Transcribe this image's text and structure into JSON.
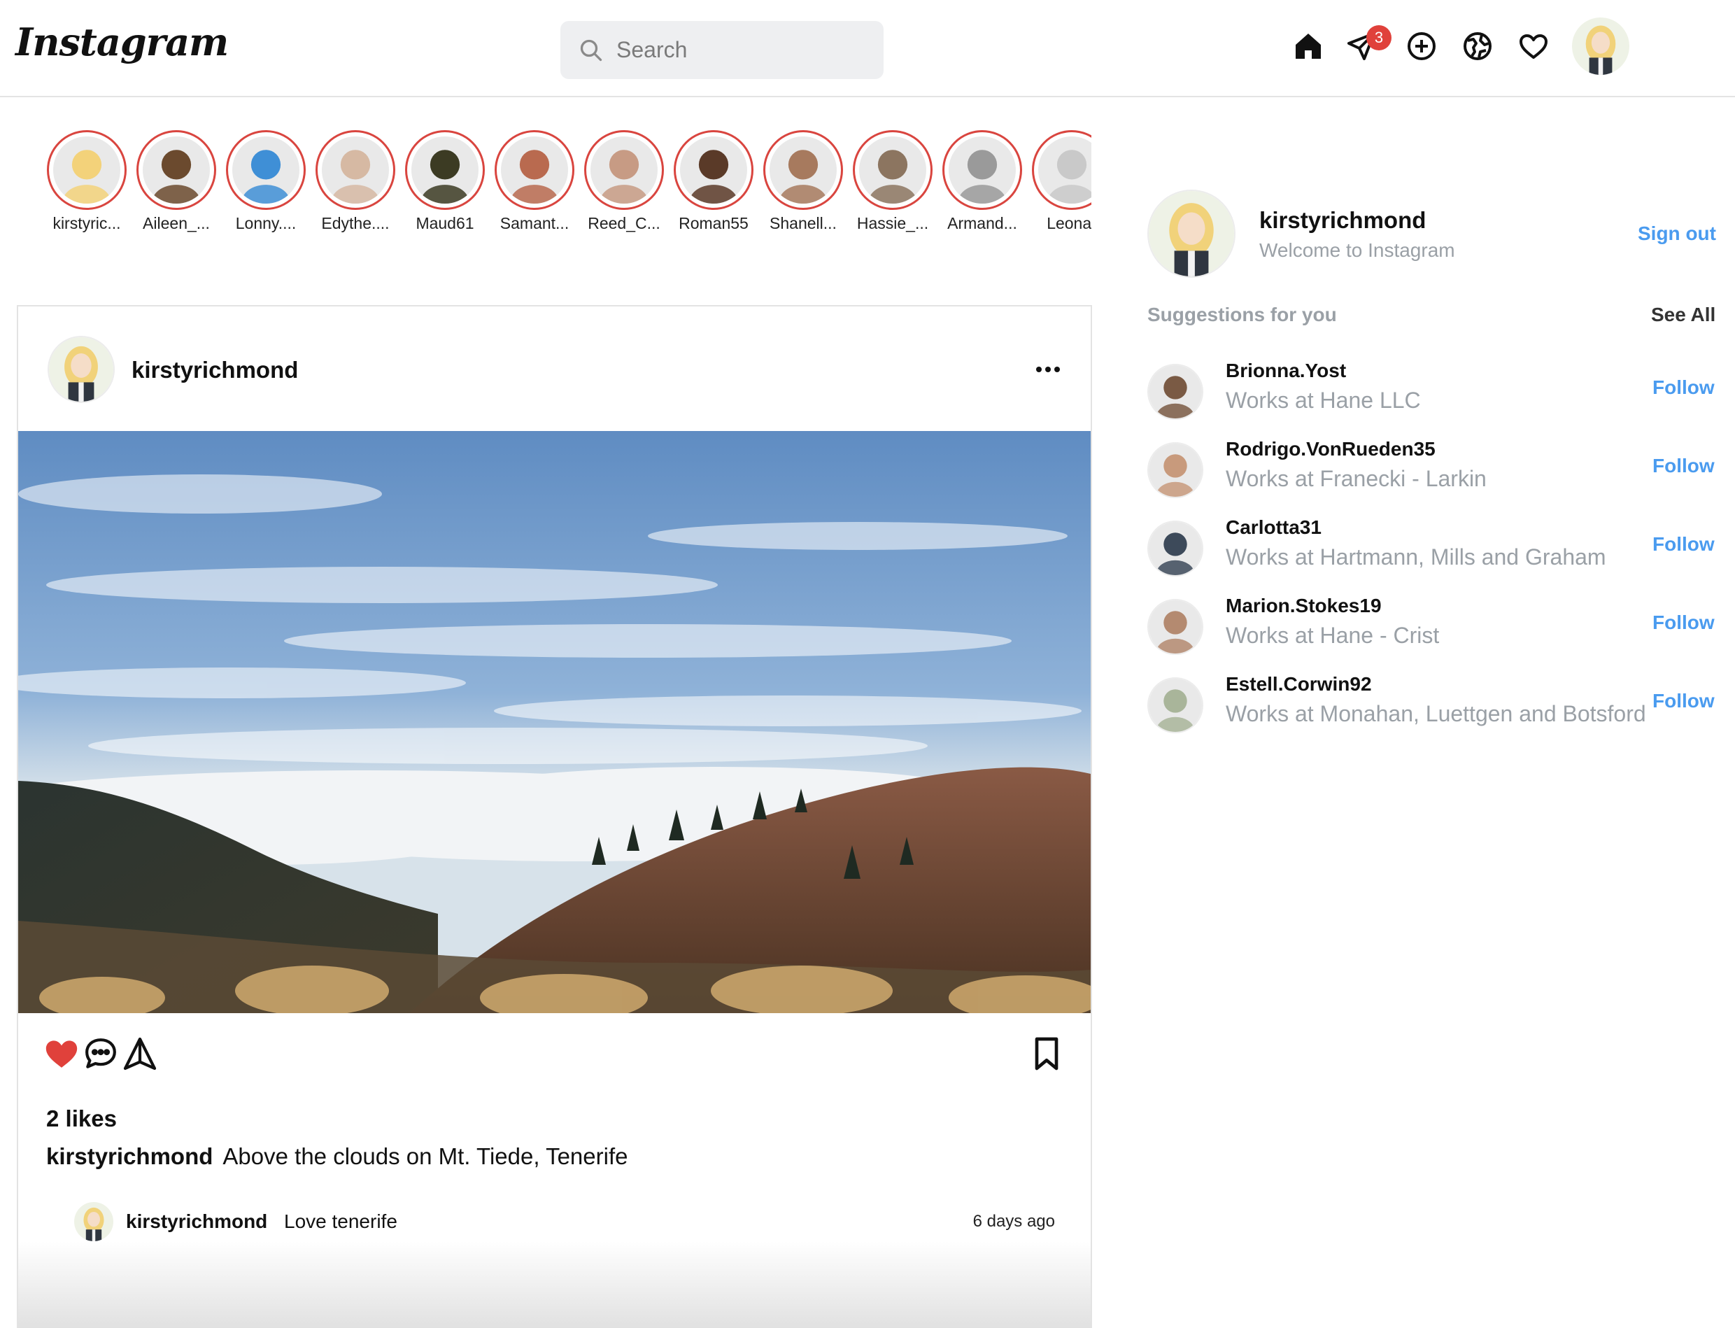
{
  "brand": {
    "logo_text": "Instagram"
  },
  "search": {
    "placeholder": "Search"
  },
  "nav": {
    "icons": [
      "home-icon",
      "direct-message-icon",
      "create-post-icon",
      "explore-icon",
      "activity-heart-icon"
    ],
    "message_badge": "3",
    "colors": {
      "badge": "#e0413b",
      "link": "#4a9bef",
      "story_ring": "#d9453f"
    }
  },
  "stories": [
    {
      "name": "kirstyric...",
      "avatar": "#f3d27a"
    },
    {
      "name": "Aileen_...",
      "avatar": "#6b4a2e"
    },
    {
      "name": "Lonny....",
      "avatar": "#3f8fd6"
    },
    {
      "name": "Edythe....",
      "avatar": "#d6b9a3"
    },
    {
      "name": "Maud61",
      "avatar": "#3c3b23"
    },
    {
      "name": "Samant...",
      "avatar": "#b96a4f"
    },
    {
      "name": "Reed_C...",
      "avatar": "#c79b84"
    },
    {
      "name": "Roman55",
      "avatar": "#5a3a28"
    },
    {
      "name": "Shanell...",
      "avatar": "#a77a5e"
    },
    {
      "name": "Hassie_...",
      "avatar": "#8c7560"
    },
    {
      "name": "Armand...",
      "avatar": "#9a9a9a"
    },
    {
      "name": "Leonar",
      "avatar": "#c9c9c9"
    }
  ],
  "post": {
    "username": "kirstyrichmond",
    "likes": "2 likes",
    "caption_user": "kirstyrichmond",
    "caption_text": "Above the clouds on Mt. Tiede, Tenerife",
    "liked": true,
    "comment": {
      "username": "kirstyrichmond",
      "text": "Love tenerife",
      "time": "6 days ago"
    }
  },
  "sidebar": {
    "username": "kirstyrichmond",
    "subtitle": "Welcome to Instagram",
    "sign_out": "Sign out",
    "suggestions_title": "Suggestions for you",
    "see_all": "See All",
    "suggestions": [
      {
        "name": "Brionna.Yost",
        "subtitle": "Works at Hane LLC",
        "action": "Follow",
        "avatar": "#7a5a44"
      },
      {
        "name": "Rodrigo.VonRueden35",
        "subtitle": "Works at Franecki - Larkin",
        "action": "Follow",
        "avatar": "#c89a7c"
      },
      {
        "name": "Carlotta31",
        "subtitle": "Works at Hartmann, Mills and Graham",
        "action": "Follow",
        "avatar": "#3d4a5a"
      },
      {
        "name": "Marion.Stokes19",
        "subtitle": "Works at Hane - Crist",
        "action": "Follow",
        "avatar": "#b48a70"
      },
      {
        "name": "Estell.Corwin92",
        "subtitle": "Works at Monahan, Luettgen and Botsford",
        "action": "Follow",
        "avatar": "#a9b59a"
      }
    ]
  }
}
